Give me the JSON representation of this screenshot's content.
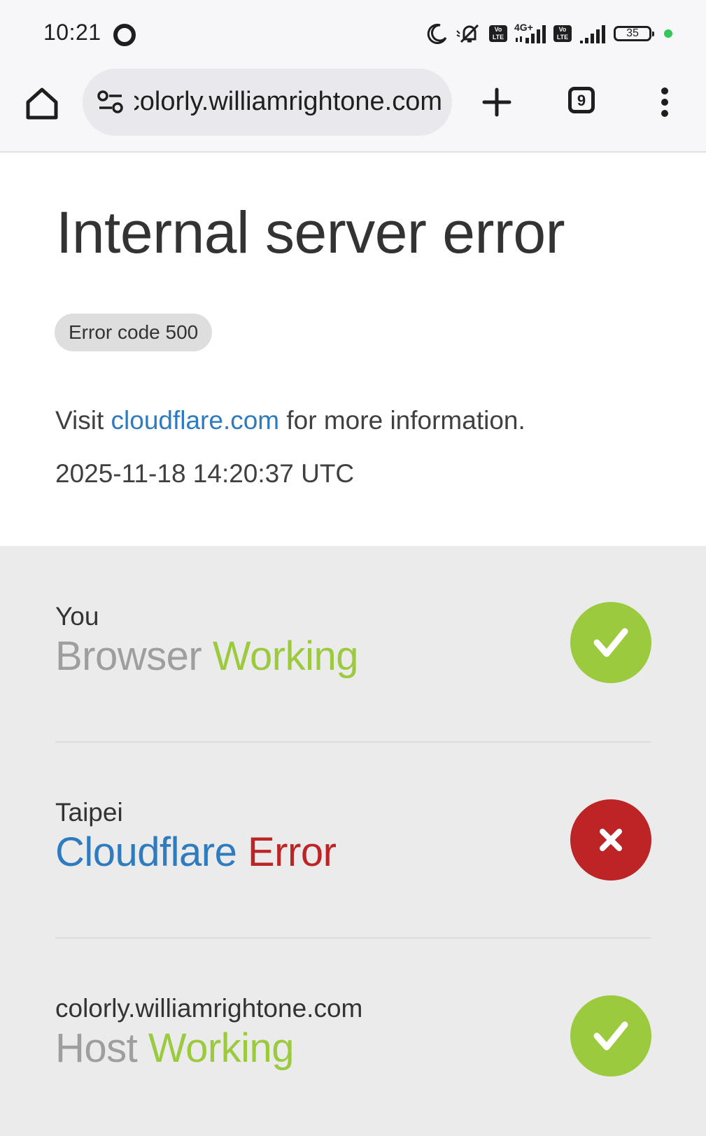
{
  "status_bar": {
    "time": "10:21",
    "network_label_1": "4G+",
    "volte_label": "Vo LTE",
    "battery_level": "35",
    "colors": {
      "active_dot": "#34c759"
    }
  },
  "browser": {
    "url": "colorly.williamrightone.com",
    "tab_count": "9",
    "icons": [
      "home-icon",
      "site-settings-icon",
      "new-tab-icon",
      "tabs-icon",
      "more-menu-icon"
    ]
  },
  "error_page": {
    "title": "Internal server error",
    "error_code": "Error code 500",
    "visit_prefix": "Visit ",
    "visit_link": "cloudflare.com",
    "visit_suffix": " for more information.",
    "timestamp": "2025-11-18 14:20:37 UTC"
  },
  "status_rows": [
    {
      "location": "You",
      "service": "Browser",
      "status": "Working",
      "state": "ok"
    },
    {
      "location": "Taipei",
      "service": "Cloudflare",
      "status": "Error",
      "state": "error"
    },
    {
      "location": "colorly.williamrightone.com",
      "service": "Host",
      "status": "Working",
      "state": "ok"
    }
  ],
  "colors": {
    "working_green": "#9bca3e",
    "error_red": "#bd2426",
    "link_blue": "#2f7bbf"
  }
}
